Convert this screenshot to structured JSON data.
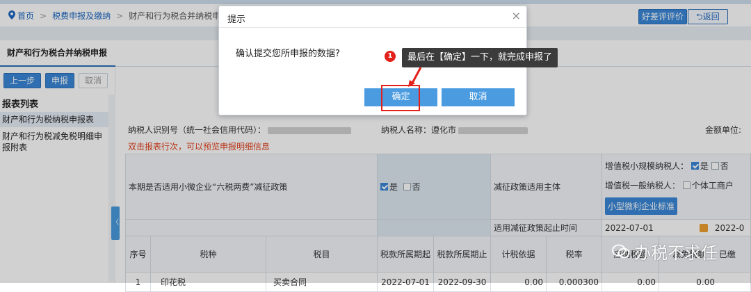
{
  "breadcrumb": {
    "home": "首页",
    "level1": "税费申报及缴纳",
    "current": "财产和行为税合并纳税申报"
  },
  "header": {
    "eval_button": "好差评评价",
    "back_button": "返回"
  },
  "tab": {
    "label": "财产和行为税合并纳税申报"
  },
  "sidebar": {
    "buttons": {
      "prev": "上一步",
      "submit": "申报",
      "cancel": "取消"
    },
    "list_title": "报表列表",
    "items": [
      {
        "label": "财产和行为税纳税申报表"
      },
      {
        "label": "财产和行为税减免税明细申报附表"
      }
    ]
  },
  "form": {
    "taxpayer_id_label": "纳税人识别号（统一社会信用代码）：",
    "taxpayer_name_label": "纳税人名称：遵化市",
    "amount_unit_label": "金额单位:",
    "hint": "双击报表行次，可以预览申报明细信息",
    "policy_question": "本期是否适用小微企业“六税两费”减征政策",
    "yes": "是",
    "no": "否",
    "policy_subject_label": "减征政策适用主体",
    "small_vat_label": "增值税小规模纳税人：",
    "general_vat_label": "增值税一般纳税人：",
    "individual_business": "个体工商户",
    "small_micro_button": "小型微利企业标准",
    "policy_period_label": "适用减征政策起止时间",
    "policy_start": "2022-07-01",
    "policy_end": "2022-0",
    "columns": [
      "序号",
      "税种",
      "税目",
      "税款所属期起",
      "税款所属期止",
      "计税依据",
      "税率",
      "应纳税额",
      "减免税额",
      "已缴"
    ],
    "rows": [
      {
        "no": "1",
        "tax": "印花税",
        "item": "买卖合同",
        "start": "2022-07-01",
        "end": "2022-09-30",
        "basis": "0.00",
        "rate": "0.000300",
        "payable": "0.00",
        "relief": "0.00"
      }
    ]
  },
  "dialog": {
    "title": "提示",
    "message": "确认提交您所申报的数据?",
    "ok": "确定",
    "cancel": "取消"
  },
  "annotation": {
    "number": "1",
    "text": "最后在【确定】一下，就完成申报了"
  },
  "watermark": "办税不求任"
}
